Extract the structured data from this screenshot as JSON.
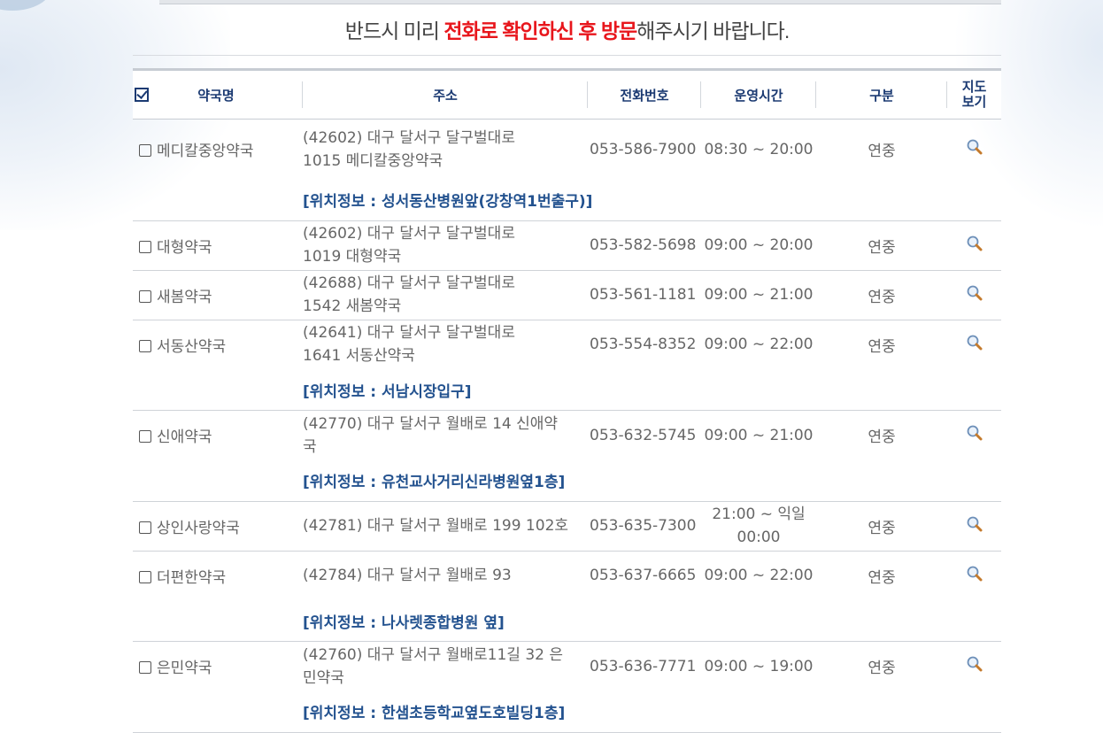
{
  "notice": {
    "part1": "반드시 미리 ",
    "highlight1": "전화로",
    "part2": " ",
    "highlight2": "확인하신 후 방문",
    "part3": "해주시기 바랍니다."
  },
  "table": {
    "headers": {
      "name": "약국명",
      "address": "주소",
      "phone": "전화번호",
      "hours": "운영시간",
      "category": "구분",
      "map_line1": "지도",
      "map_line2": "보기"
    },
    "rows": [
      {
        "name": "메디칼중앙약국",
        "addr1": "(42602) 대구 달서구 달구벌대로",
        "addr2": "1015 메디칼중앙약국",
        "phone": "053-586-7900",
        "hours1": "08:30 ~ 20:00",
        "hours2": "",
        "category": "연중",
        "location": "[위치정보 : 성서동산병원앞(강창역1번출구)]"
      },
      {
        "name": "대형약국",
        "addr1": "(42602) 대구 달서구 달구벌대로",
        "addr2": "1019 대형약국",
        "phone": "053-582-5698",
        "hours1": "09:00 ~ 20:00",
        "hours2": "",
        "category": "연중",
        "location": ""
      },
      {
        "name": "새봄약국",
        "addr1": "(42688) 대구 달서구 달구벌대로",
        "addr2": "1542 새봄약국",
        "phone": "053-561-1181",
        "hours1": "09:00 ~ 21:00",
        "hours2": "",
        "category": "연중",
        "location": ""
      },
      {
        "name": "서동산약국",
        "addr1": "(42641) 대구 달서구 달구벌대로",
        "addr2": "1641 서동산약국",
        "phone": "053-554-8352",
        "hours1": "09:00 ~ 22:00",
        "hours2": "",
        "category": "연중",
        "location": "[위치정보 : 서남시장입구]"
      },
      {
        "name": "신애약국",
        "addr1": "(42770) 대구 달서구 월배로 14 신애약",
        "addr2": "국",
        "phone": "053-632-5745",
        "hours1": "09:00 ~ 21:00",
        "hours2": "",
        "category": "연중",
        "location": "[위치정보 : 유천교사거리신라병원옆1층]"
      },
      {
        "name": "상인사랑약국",
        "addr1": "(42781) 대구 달서구 월배로 199 102호",
        "addr2": "",
        "phone": "053-635-7300",
        "hours1": "21:00 ~ 익일",
        "hours2": "00:00",
        "category": "연중",
        "location": ""
      },
      {
        "name": "더편한약국",
        "addr1": "(42784) 대구 달서구 월배로 93",
        "addr2": "",
        "phone": "053-637-6665",
        "hours1": "09:00 ~ 22:00",
        "hours2": "",
        "category": "연중",
        "location": "[위치정보 : 나사렛종합병원 옆]"
      },
      {
        "name": "은민약국",
        "addr1": "(42760) 대구 달서구 월배로11길 32 은",
        "addr2": "민약국",
        "phone": "053-636-7771",
        "hours1": "09:00 ~ 19:00",
        "hours2": "",
        "category": "연중",
        "location": "[위치정보 : 한샘초등학교옆도호빌딩1층]"
      }
    ]
  }
}
